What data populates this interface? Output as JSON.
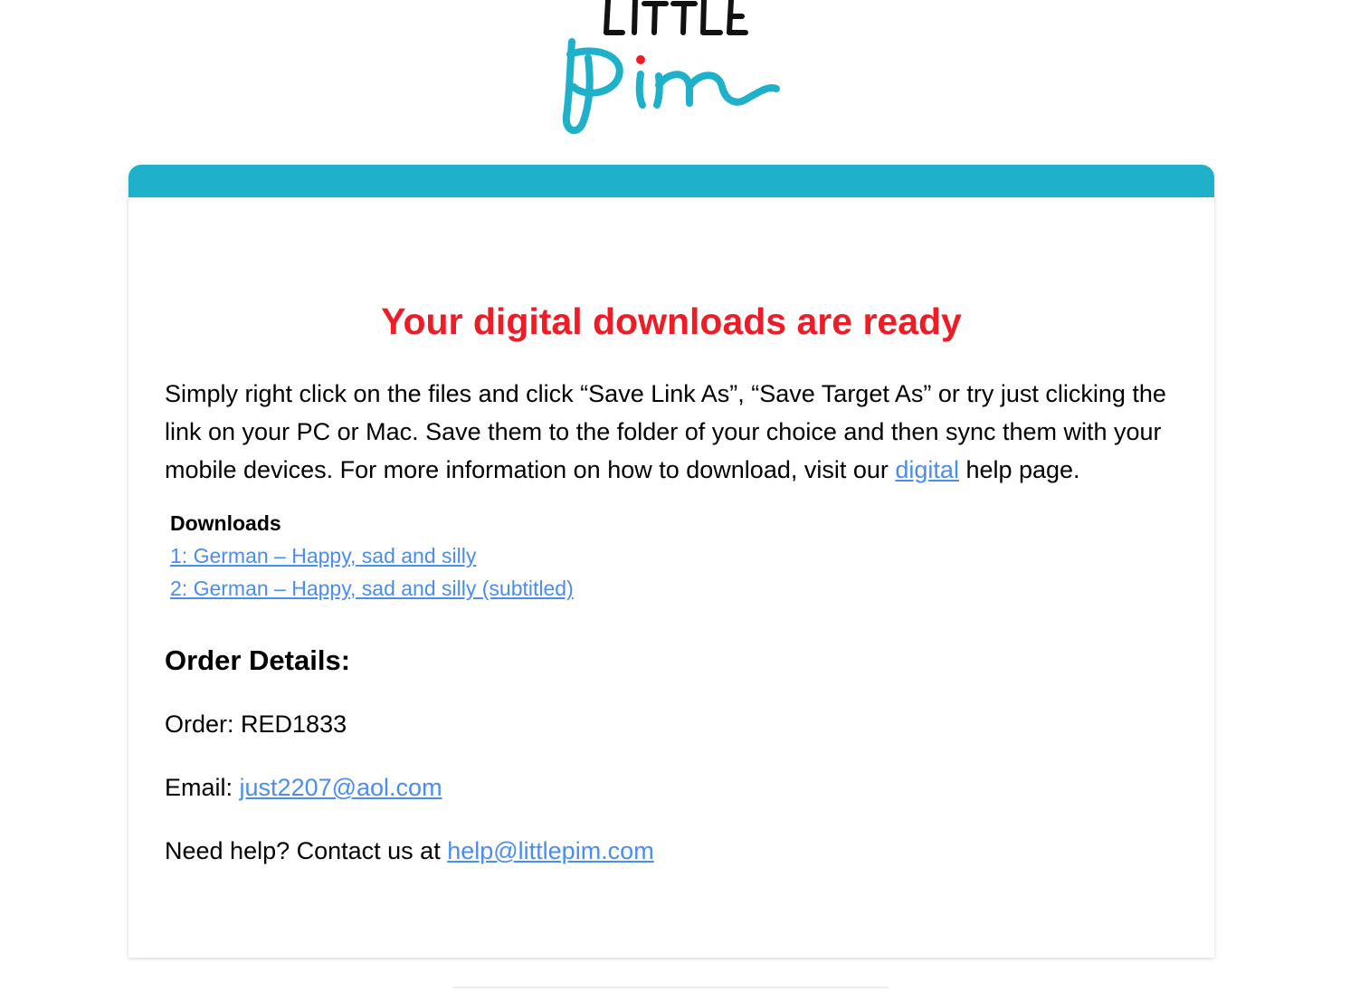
{
  "logo": {
    "top_text": "LITTLE",
    "name": "Pim",
    "colors": {
      "wordmark": "#1eb1c9",
      "dot": "#ee1c25",
      "top_text": "#111111"
    }
  },
  "colors": {
    "accent_bar": "#1eb1c9",
    "headline": "#ee1c25",
    "link": "#4a8df0"
  },
  "headline": "Your digital downloads are ready",
  "intro": {
    "before_link": "Simply right click on the files and click “Save Link As”, “Save Target As” or try just clicking the link on your PC or Mac. Save them to the folder of your choice and then sync them with your mobile devices. For more information on how to download, visit our ",
    "link_text": "digital",
    "after_link": " help page."
  },
  "downloads": {
    "title": "Downloads",
    "items": [
      {
        "label": "1: German – Happy, sad and silly"
      },
      {
        "label": "2: German – Happy, sad and silly (subtitled)"
      }
    ]
  },
  "order": {
    "title": "Order Details:",
    "order_label": "Order: ",
    "order_number": "RED1833",
    "email_label": "Email: ",
    "email": "just2207@aol.com",
    "help_label": "Need help? Contact us at ",
    "help_email": "help@littlepim.com"
  }
}
